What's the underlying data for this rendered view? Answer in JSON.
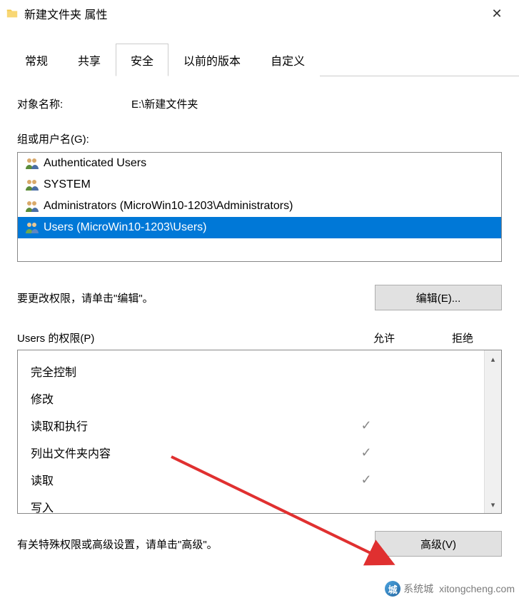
{
  "titlebar": {
    "title": "新建文件夹 属性"
  },
  "tabs": [
    {
      "label": "常规",
      "active": false
    },
    {
      "label": "共享",
      "active": false
    },
    {
      "label": "安全",
      "active": true
    },
    {
      "label": "以前的版本",
      "active": false
    },
    {
      "label": "自定义",
      "active": false
    }
  ],
  "object": {
    "label": "对象名称:",
    "value": "E:\\新建文件夹"
  },
  "groups": {
    "label": "组或用户名(G):",
    "items": [
      {
        "name": "Authenticated Users",
        "selected": false
      },
      {
        "name": "SYSTEM",
        "selected": false
      },
      {
        "name": "Administrators (MicroWin10-1203\\Administrators)",
        "selected": false
      },
      {
        "name": "Users (MicroWin10-1203\\Users)",
        "selected": true
      }
    ]
  },
  "edit": {
    "hint": "要更改权限，请单击\"编辑\"。",
    "button": "编辑(E)..."
  },
  "permissions": {
    "header_label": "Users 的权限(P)",
    "allow_label": "允许",
    "deny_label": "拒绝",
    "rows": [
      {
        "name": "完全控制",
        "allow": false,
        "deny": false
      },
      {
        "name": "修改",
        "allow": false,
        "deny": false
      },
      {
        "name": "读取和执行",
        "allow": true,
        "deny": false
      },
      {
        "name": "列出文件夹内容",
        "allow": true,
        "deny": false
      },
      {
        "name": "读取",
        "allow": true,
        "deny": false
      },
      {
        "name": "写入",
        "allow": false,
        "deny": false
      }
    ]
  },
  "advanced": {
    "hint": "有关特殊权限或高级设置，请单击\"高级\"。",
    "button": "高级(V)"
  },
  "watermark": {
    "brand": "系统城",
    "url": "xitongcheng.com"
  }
}
